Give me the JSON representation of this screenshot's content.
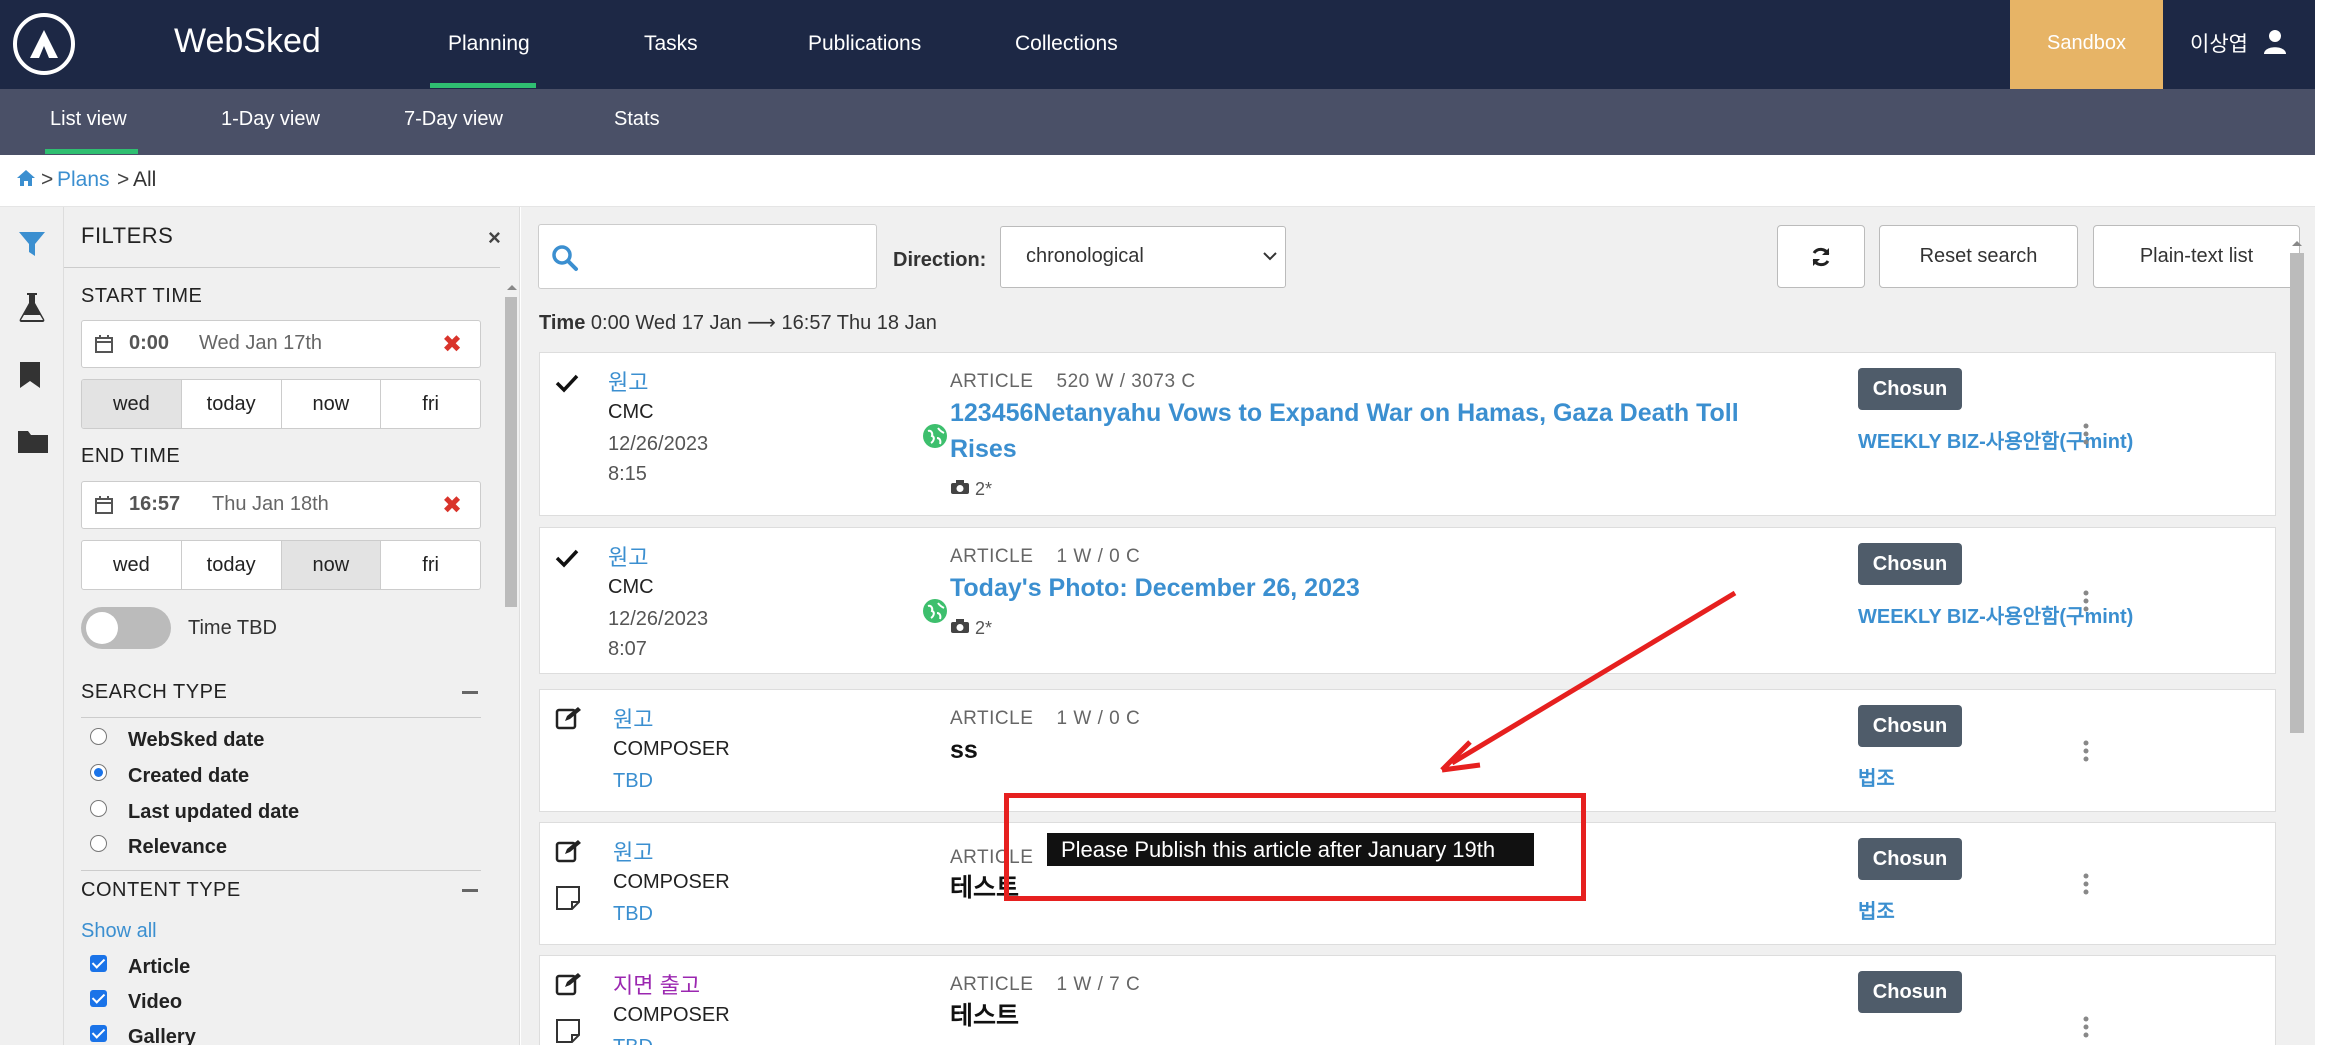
{
  "app": {
    "name": "WebSked"
  },
  "topnav": {
    "items": [
      "Planning",
      "Tasks",
      "Publications",
      "Collections"
    ],
    "active": "Planning",
    "sandbox_label": "Sandbox",
    "user_name": "이상엽"
  },
  "subnav": {
    "items": [
      "List view",
      "1-Day view",
      "7-Day view",
      "Stats"
    ],
    "active": "List view"
  },
  "breadcrumb": {
    "sep": ">",
    "plans": "Plans",
    "current": "All"
  },
  "rail": {
    "icons": [
      "filter-icon",
      "flask-icon",
      "bookmark-icon",
      "folder-icon"
    ]
  },
  "filters": {
    "title": "FILTERS",
    "close": "×",
    "start_time": {
      "label": "START TIME",
      "time": "0:00",
      "date": "Wed Jan 17th",
      "buttons": [
        "wed",
        "today",
        "now",
        "fri"
      ],
      "active": "wed"
    },
    "end_time": {
      "label": "END TIME",
      "time": "16:57",
      "date": "Thu Jan 18th",
      "buttons": [
        "wed",
        "today",
        "now",
        "fri"
      ],
      "active": "now"
    },
    "time_tbd_label": "Time TBD",
    "search_type": {
      "title": "SEARCH TYPE",
      "options": [
        "WebSked date",
        "Created date",
        "Last updated date",
        "Relevance"
      ],
      "selected": "Created date"
    },
    "content_type": {
      "title": "CONTENT TYPE",
      "show_all": "Show all",
      "options": [
        "Article",
        "Video",
        "Gallery"
      ]
    }
  },
  "toolbar": {
    "search_placeholder": "",
    "direction_label": "Direction:",
    "direction_value": "chronological",
    "reset_label": "Reset search",
    "plaintext_label": "Plain-text list"
  },
  "timeline": {
    "label": "Time",
    "range": "0:00 Wed 17 Jan ⟶ 16:57 Thu 18 Jan"
  },
  "items": [
    {
      "status": "check",
      "source": "원고",
      "origin": "CMC",
      "date": "12/26/2023",
      "time": "8:15",
      "type": "ARTICLE",
      "counts": "520 W / 3073 C",
      "title_line1": "123456Netanyahu Vows to Expand War on Hamas, Gaza Death Toll",
      "title_line2": "Rises",
      "photos": "2*",
      "badge": "Chosun",
      "section": "WEEKLY BIZ-사용안함(구mint)"
    },
    {
      "status": "check",
      "source": "원고",
      "origin": "CMC",
      "date": "12/26/2023",
      "time": "8:07",
      "type": "ARTICLE",
      "counts": "1 W / 0 C",
      "title_line1": "Today's Photo: December 26, 2023",
      "photos": "2*",
      "badge": "Chosun",
      "section": "WEEKLY BIZ-사용안함(구mint)"
    },
    {
      "status": "edit",
      "source": "원고",
      "origin": "COMPOSER",
      "date": "TBD",
      "type": "ARTICLE",
      "counts": "1 W / 0 C",
      "title_line1": "ss",
      "badge": "Chosun",
      "section": "법조"
    },
    {
      "status": "edit",
      "source": "원고",
      "origin": "COMPOSER",
      "date": "TBD",
      "type": "ARTICLE",
      "title_line1": "테스트",
      "badge": "Chosun",
      "section": "법조"
    },
    {
      "status": "edit",
      "source": "지면 출고",
      "origin": "COMPOSER",
      "date": "TBD",
      "type": "ARTICLE",
      "counts": "1 W / 7 C",
      "title_line1": "테스트",
      "badge": "Chosun"
    }
  ],
  "tooltip": {
    "text": "Please Publish this article after January 19th"
  },
  "colors": {
    "nav_bg": "#1d2845",
    "subnav_bg": "#4a5067",
    "accent_green": "#2fbf71",
    "sandbox": "#e7b466",
    "link": "#3b8fd0",
    "badge": "#4f5c6a",
    "annotation": "#e6201f"
  }
}
